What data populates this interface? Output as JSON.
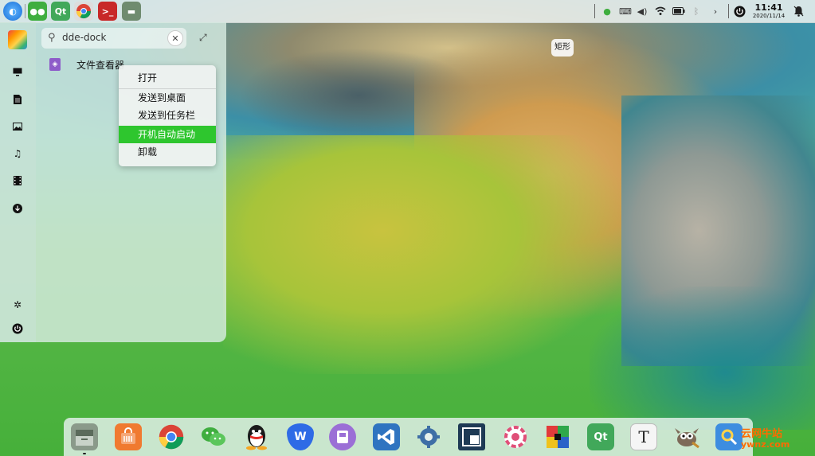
{
  "topbar": {
    "left_apps": [
      {
        "name": "Deepin launcher",
        "icon": "deepin-icon"
      },
      {
        "name": "WeChat",
        "icon": "wechat-icon"
      },
      {
        "name": "Qt Creator",
        "icon": "qt-icon",
        "label": "Qt"
      },
      {
        "name": "Chrome",
        "icon": "chrome-icon"
      },
      {
        "name": "Terminal",
        "icon": "terminal-icon",
        "label": ">_"
      },
      {
        "name": "File Manager",
        "icon": "file-manager-icon"
      }
    ],
    "tray_icons": [
      "wechat-tray-icon",
      "keyboard-icon",
      "volume-icon",
      "wifi-icon",
      "battery-icon",
      "bluetooth-icon",
      "chevron-right-icon",
      "power-icon",
      "notification-icon"
    ],
    "clock": {
      "time": "11:41",
      "date": "2020/11/14"
    }
  },
  "launcher": {
    "search": {
      "value": "dde-dock"
    },
    "sidebar_icons": [
      "avatar",
      "computer-icon",
      "document-icon",
      "picture-icon",
      "music-icon",
      "video-icon",
      "download-icon",
      "settings-icon",
      "power-icon"
    ],
    "results": [
      {
        "label": "文件查看器",
        "icon": "file-viewer-icon"
      }
    ]
  },
  "context_menu": {
    "items": [
      {
        "label": "打开"
      },
      {
        "label": "发送到桌面"
      },
      {
        "label": "发送到任务栏"
      },
      {
        "label": "开机自动启动",
        "active": true
      },
      {
        "label": "卸载"
      }
    ]
  },
  "tooltip": {
    "text": "矩形"
  },
  "dock": {
    "apps": [
      {
        "name": "File Manager",
        "icon": "file-manager-icon",
        "color": "#8a9a8a"
      },
      {
        "name": "App Store",
        "icon": "app-store-icon",
        "color": "#f07a30"
      },
      {
        "name": "Chrome",
        "icon": "chrome-icon",
        "color": "#e8e8e8"
      },
      {
        "name": "WeChat",
        "icon": "wechat-icon",
        "color": "#3fae3f"
      },
      {
        "name": "QQ",
        "icon": "qq-icon",
        "color": "#222222"
      },
      {
        "name": "WPS",
        "icon": "wps-icon",
        "color": "#2e6be6",
        "label": "W"
      },
      {
        "name": "Deepin Music",
        "icon": "music-player-icon",
        "color": "#9b6fd6"
      },
      {
        "name": "VS Code",
        "icon": "vscode-icon",
        "color": "#2f74c0"
      },
      {
        "name": "Settings",
        "icon": "settings-icon",
        "color": "#3f6fa6"
      },
      {
        "name": "Dock Preview",
        "icon": "window-icon",
        "color": "#1e3a55"
      },
      {
        "name": "Color Picker",
        "icon": "color-picker-icon",
        "color": "#e04f78"
      },
      {
        "name": "Multicolor App",
        "icon": "grid-app-icon",
        "color": "#e23b3b"
      },
      {
        "name": "Qt Designer",
        "icon": "qt-icon",
        "color": "#41a85a",
        "label": "Qt"
      },
      {
        "name": "Typora",
        "icon": "text-editor-icon",
        "color": "#f5f5f5",
        "label": "T"
      },
      {
        "name": "GIMP",
        "icon": "gimp-icon",
        "color": "#7d6a58"
      },
      {
        "name": "Search",
        "icon": "search-app-icon",
        "color": "#3d8de0"
      }
    ]
  },
  "watermark": {
    "text": "云网牛站",
    "sub": "ywnz.com"
  },
  "colors": {
    "menu_highlight": "#2ec62e",
    "watermark": "#ff6a00"
  }
}
